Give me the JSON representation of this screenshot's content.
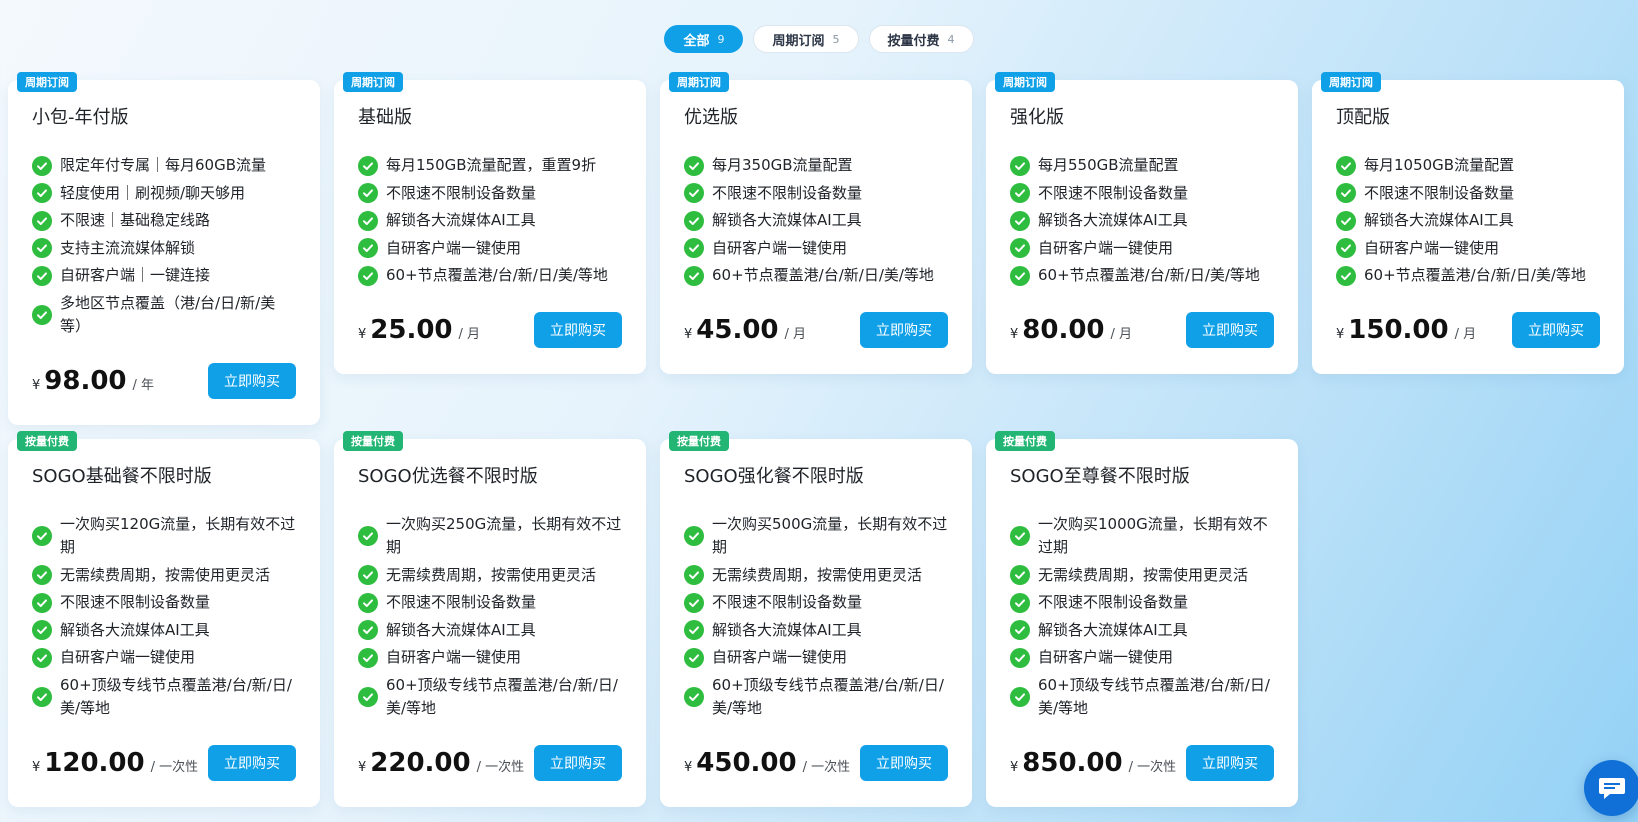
{
  "filters": [
    {
      "label": "全部",
      "count": "9"
    },
    {
      "label": "周期订阅",
      "count": "5"
    },
    {
      "label": "按量付费",
      "count": "4"
    }
  ],
  "buy_label": "立即购买",
  "currency": "¥",
  "colors": {
    "accent": "#10a0e8",
    "subscription_badge": "#10a0e8",
    "payg_badge": "#22b573",
    "check": "#2ebd3f"
  },
  "rows": [
    [
      {
        "badge": "周期订阅",
        "badge_type": "sub",
        "title": "小包-年付版",
        "features": [
          "限定年付专属｜每月60GB流量",
          "轻度使用｜刷视频/聊天够用",
          "不限速｜基础稳定线路",
          "支持主流流媒体解锁",
          "自研客户端｜一键连接",
          "多地区节点覆盖（港/台/日/新/美等）"
        ],
        "price": "98.00",
        "unit": "/ 年"
      },
      {
        "badge": "周期订阅",
        "badge_type": "sub",
        "title": "基础版",
        "features": [
          "每月150GB流量配置，重置9折",
          "不限速不限制设备数量",
          "解锁各大流媒体AI工具",
          "自研客户端一键使用",
          "60+节点覆盖港/台/新/日/美/等地"
        ],
        "price": "25.00",
        "unit": "/ 月"
      },
      {
        "badge": "周期订阅",
        "badge_type": "sub",
        "title": "优选版",
        "features": [
          "每月350GB流量配置",
          "不限速不限制设备数量",
          "解锁各大流媒体AI工具",
          "自研客户端一键使用",
          "60+节点覆盖港/台/新/日/美/等地"
        ],
        "price": "45.00",
        "unit": "/ 月"
      },
      {
        "badge": "周期订阅",
        "badge_type": "sub",
        "title": "强化版",
        "features": [
          "每月550GB流量配置",
          "不限速不限制设备数量",
          "解锁各大流媒体AI工具",
          "自研客户端一键使用",
          "60+节点覆盖港/台/新/日/美/等地"
        ],
        "price": "80.00",
        "unit": "/ 月"
      },
      {
        "badge": "周期订阅",
        "badge_type": "sub",
        "title": "顶配版",
        "features": [
          "每月1050GB流量配置",
          "不限速不限制设备数量",
          "解锁各大流媒体AI工具",
          "自研客户端一键使用",
          "60+节点覆盖港/台/新/日/美/等地"
        ],
        "price": "150.00",
        "unit": "/ 月"
      }
    ],
    [
      {
        "badge": "按量付费",
        "badge_type": "pay",
        "title": "SOGO基础餐不限时版",
        "features": [
          "一次购买120G流量，长期有效不过期",
          "无需续费周期，按需使用更灵活",
          "不限速不限制设备数量",
          "解锁各大流媒体AI工具",
          "自研客户端一键使用",
          "60+顶级专线节点覆盖港/台/新/日/美/等地"
        ],
        "price": "120.00",
        "unit": "/ 一次性"
      },
      {
        "badge": "按量付费",
        "badge_type": "pay",
        "title": "SOGO优选餐不限时版",
        "features": [
          "一次购买250G流量，长期有效不过期",
          "无需续费周期，按需使用更灵活",
          "不限速不限制设备数量",
          "解锁各大流媒体AI工具",
          "自研客户端一键使用",
          "60+顶级专线节点覆盖港/台/新/日/美/等地"
        ],
        "price": "220.00",
        "unit": "/ 一次性"
      },
      {
        "badge": "按量付费",
        "badge_type": "pay",
        "title": "SOGO强化餐不限时版",
        "features": [
          "一次购买500G流量，长期有效不过期",
          "无需续费周期，按需使用更灵活",
          "不限速不限制设备数量",
          "解锁各大流媒体AI工具",
          "自研客户端一键使用",
          "60+顶级专线节点覆盖港/台/新/日/美/等地"
        ],
        "price": "450.00",
        "unit": "/ 一次性"
      },
      {
        "badge": "按量付费",
        "badge_type": "pay",
        "title": "SOGO至尊餐不限时版",
        "features": [
          "一次购买1000G流量，长期有效不过期",
          "无需续费周期，按需使用更灵活",
          "不限速不限制设备数量",
          "解锁各大流媒体AI工具",
          "自研客户端一键使用",
          "60+顶级专线节点覆盖港/台/新/日/美/等地"
        ],
        "price": "850.00",
        "unit": "/ 一次性"
      }
    ]
  ]
}
